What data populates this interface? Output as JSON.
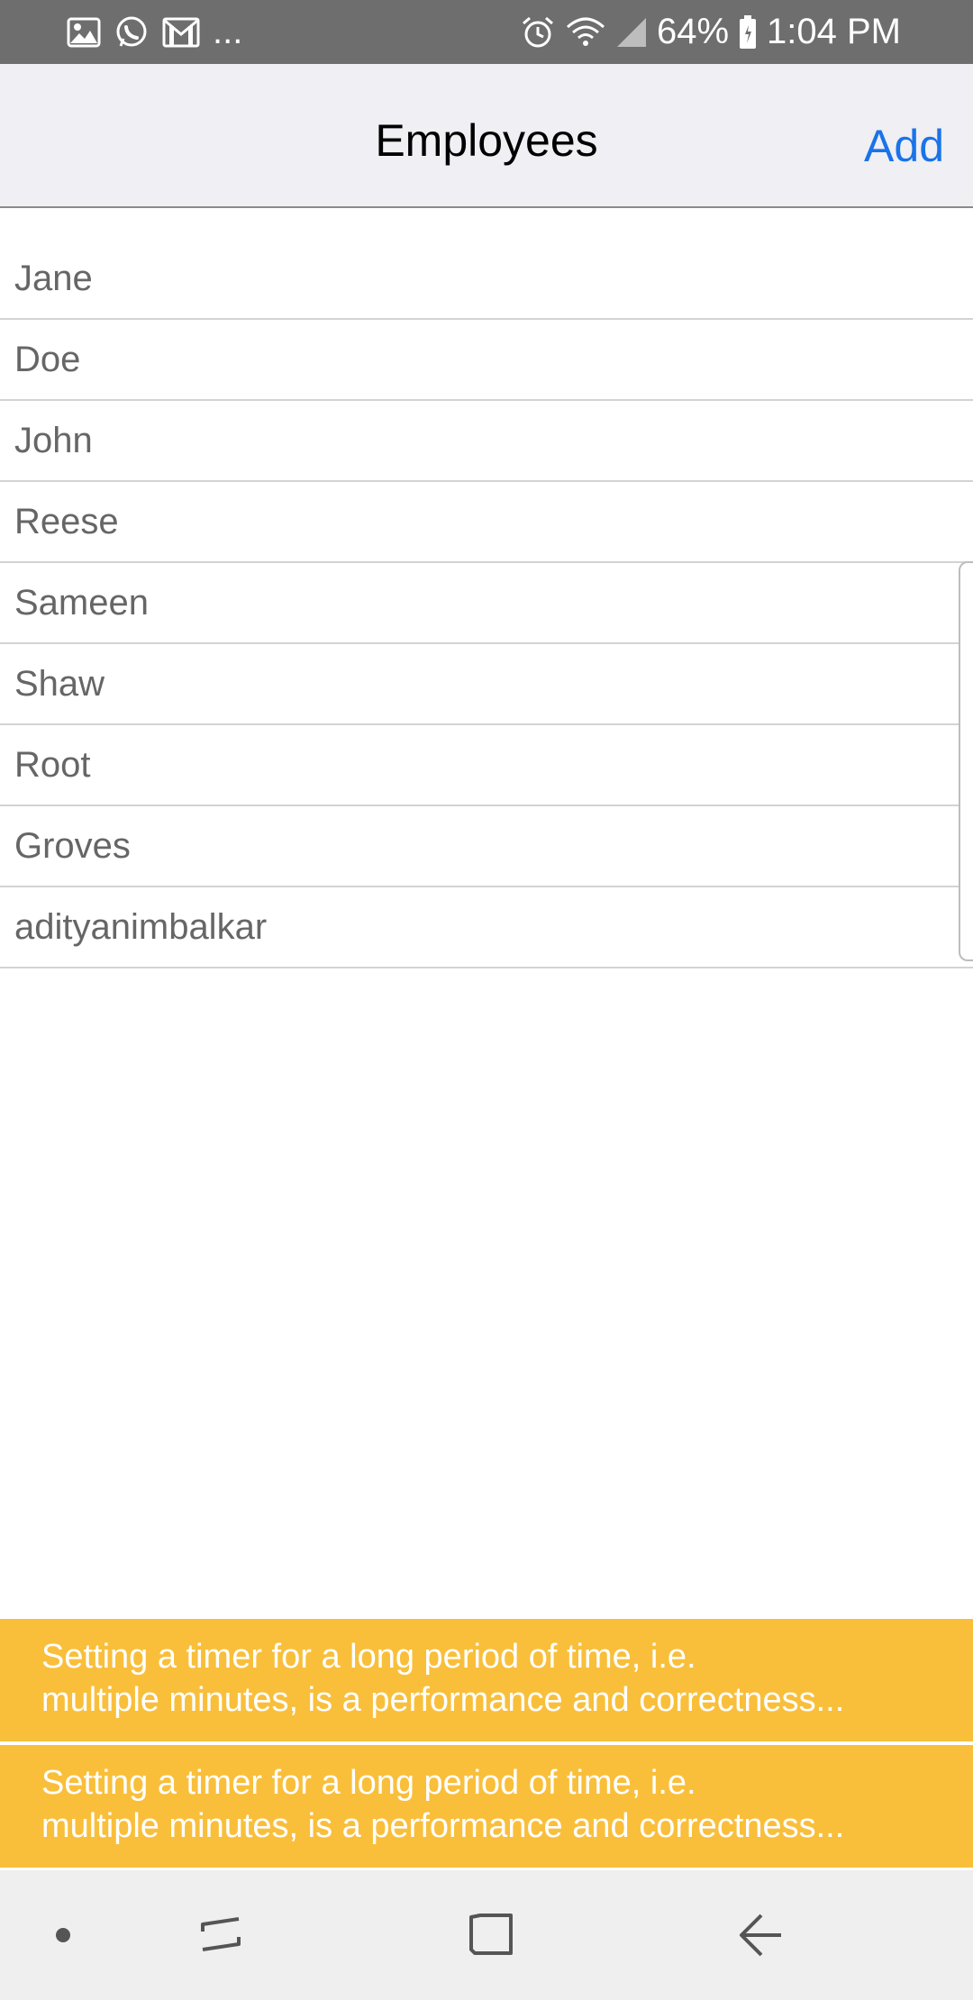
{
  "status_bar": {
    "battery": "64%",
    "time": "1:04 PM",
    "ellipsis": "...",
    "left_icons": [
      "image-icon",
      "whatsapp-icon",
      "gmail-icon"
    ],
    "right_icons": [
      "alarm-icon",
      "wifi-icon",
      "signal-icon",
      "battery-icon"
    ]
  },
  "header": {
    "title": "Employees",
    "add_label": "Add",
    "accent": "#1a73e8"
  },
  "employees": [
    "Jane",
    "Doe",
    "John",
    "Reese",
    "Sameen",
    "Shaw",
    "Root",
    "Groves",
    "adityanimbalkar"
  ],
  "toasts": [
    {
      "line1": "Setting a timer for a long period of time, i.e.",
      "line2": "multiple minutes, is a performance and correctness..."
    },
    {
      "line1": "Setting a timer for a long period of time, i.e.",
      "line2": "multiple minutes, is a performance and correctness..."
    }
  ],
  "toast_color": "#f9bf3b",
  "nav_bar": {
    "icons": [
      "dot-icon",
      "recent-apps-icon",
      "home-icon",
      "back-icon"
    ]
  }
}
